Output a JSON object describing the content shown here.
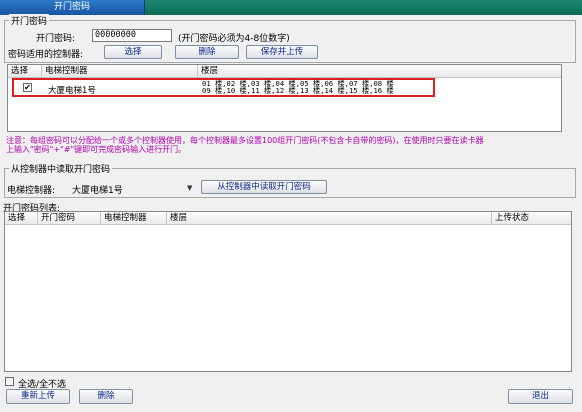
{
  "tabs": {
    "active": "开门密码"
  },
  "password_group": {
    "legend": "开门密码",
    "password_label": "开门密码:",
    "password_value": "00000000",
    "password_hint": "(开门密码必须为4-8位数字)",
    "controllers_label": "密码适用的控制器:",
    "select_button": "选择",
    "delete_button": "删除",
    "save_upload_button": "保存并上传"
  },
  "controller_table": {
    "headers": [
      "选择",
      "电梯控制器",
      "楼层"
    ],
    "rows": [
      {
        "checked": "✔",
        "controller": "大厦电梯1号",
        "floors_line1": "01 楼,02 楼,03 楼,04 楼,05 楼,06 楼,07 楼,08 楼",
        "floors_line2": "09 楼,10 楼,11 楼,12 楼,13 楼,14 楼,15 楼,16 楼"
      }
    ]
  },
  "notice": {
    "line1": "注意：每组密码可以分配给一个或多个控制器使用，每个控制器最多设置100组开门密码(不包含卡自带的密码)，在使用时只要在读卡器",
    "line2": "上输入\"密码\"+\"#\"键即可完成密码输入进行开门。"
  },
  "read_group": {
    "legend": "从控制器中读取开门密码",
    "controller_label": "电梯控制器:",
    "controller_value": "大厦电梯1号",
    "read_button": "从控制器中读取开门密码"
  },
  "password_list": {
    "label": "开门密码列表:",
    "headers": [
      "选择",
      "开门密码",
      "电梯控制器",
      "楼层",
      "上传状态"
    ]
  },
  "footer": {
    "select_all_label": "全选/全不选",
    "reupload_button": "重新上传",
    "delete_button": "删除",
    "exit_button": "退出"
  },
  "colors": {
    "tab_active": "#1f63b5",
    "tab_strip": "#0f7a62",
    "highlight_border": "#e02020",
    "notice_text": "#b400b4",
    "button_text": "#0b2a8f"
  }
}
